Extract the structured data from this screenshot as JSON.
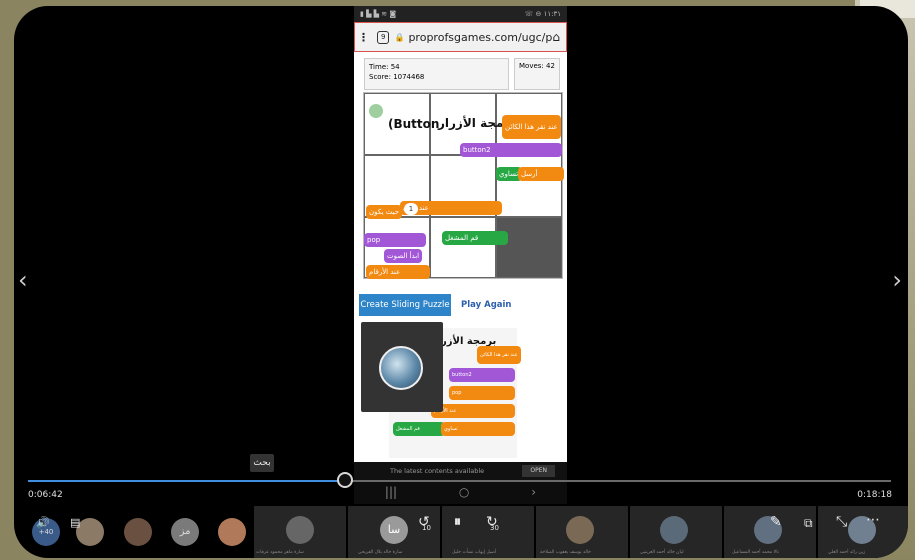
{
  "phone": {
    "status_left": "▮ ▙ ▙ ≋ ◙",
    "status_right": "☏ ⊖ ١١:٣١",
    "url": "proprofsgames.com/ugc/p",
    "menu_icon": "⋮",
    "tab_count": "9",
    "time_label": "Time: 54",
    "score_label": "Score: 1074468",
    "moves_label": "Moves: 42",
    "puzzle": {
      "title_ar": "برمجة الأزرار",
      "title_en": "(Button",
      "blocks": [
        "عند نقر هذا الكائن",
        "button2",
        "تساوي",
        "أرسل",
        "عند تلقي",
        "حيث يكون",
        "1",
        "تغير",
        "pop",
        "ابدأ الصوت",
        "عند الأرقام",
        "قم المشغل"
      ]
    },
    "create_button": "Create Sliding Puzzle",
    "play_again": "Play Again",
    "preview": {
      "title_ar": "برمجة الأزر",
      "blocks": [
        "عند نقر هذا الكائن",
        "button2",
        "pop",
        "ابدأ الصوت",
        "عند الأرقام",
        "1",
        "قم المشغل",
        "تساوي"
      ]
    },
    "latest_text": "The latest contents available",
    "open_button": "OPEN",
    "nav": [
      "|||",
      "○",
      "›"
    ]
  },
  "player": {
    "tooltip": "بحث",
    "elapsed": "0:06:42",
    "duration": "0:18:18",
    "progress": 0.366,
    "volume_badge": "+40",
    "skip_back_label": "10",
    "skip_forward_label": "30",
    "nav_prev": "‹",
    "nav_next": "›"
  },
  "participants": {
    "av_initials": "مز",
    "av2_initials": "سا",
    "names": [
      "سارة ماهر محمود عرفات",
      "سارة خالد بلال الفريحي",
      "أصيل إيهاب نشأت خليل",
      "خالد يوسف يعقوب الصلاحة",
      "ليان خالد أحمد العرينيي",
      "تالا محمد أحمد المساعيل",
      "زين رائد أحمد العلي"
    ]
  },
  "colors": {
    "accent": "#3f8ee0",
    "orange_block": "#f28a12",
    "purple_block": "#a257d6",
    "green_block": "#27a844"
  }
}
